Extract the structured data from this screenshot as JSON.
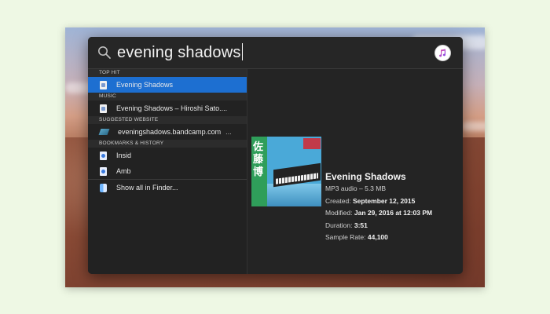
{
  "search": {
    "query": "evening shadows"
  },
  "sections": [
    {
      "header": "TOP HIT",
      "rows": [
        {
          "label": "Evening Shadows",
          "icon": "document-icon",
          "selected": true
        }
      ]
    },
    {
      "header": "MUSIC",
      "rows": [
        {
          "label": "Evening Shadows – Hiroshi Sato....",
          "icon": "document-icon"
        }
      ]
    },
    {
      "header": "SUGGESTED WEBSITE",
      "rows": [
        {
          "label": "eveningshadows.bandcamp.com",
          "suffix": "...",
          "icon": "website-icon"
        }
      ]
    },
    {
      "header": "BOOKMARKS & HISTORY",
      "rows": [
        {
          "label": "Insid",
          "icon": "bookmark-icon"
        },
        {
          "label": "Amb",
          "icon": "bookmark-icon"
        }
      ]
    }
  ],
  "show_all": {
    "label": "Show all in Finder..."
  },
  "preview": {
    "title": "Evening Shadows",
    "kind": "MP3 audio – 5.3 MB",
    "created_label": "Created:",
    "created_value": "September 12, 2015",
    "modified_label": "Modified:",
    "modified_value": "Jan 29, 2016 at 12:03 PM",
    "duration_label": "Duration:",
    "duration_value": "3:51",
    "sample_rate_label": "Sample Rate:",
    "sample_rate_value": "44,100",
    "album_art_text": "佐藤博"
  },
  "colors": {
    "selection": "#1d6fd1",
    "panel": "#232323"
  }
}
